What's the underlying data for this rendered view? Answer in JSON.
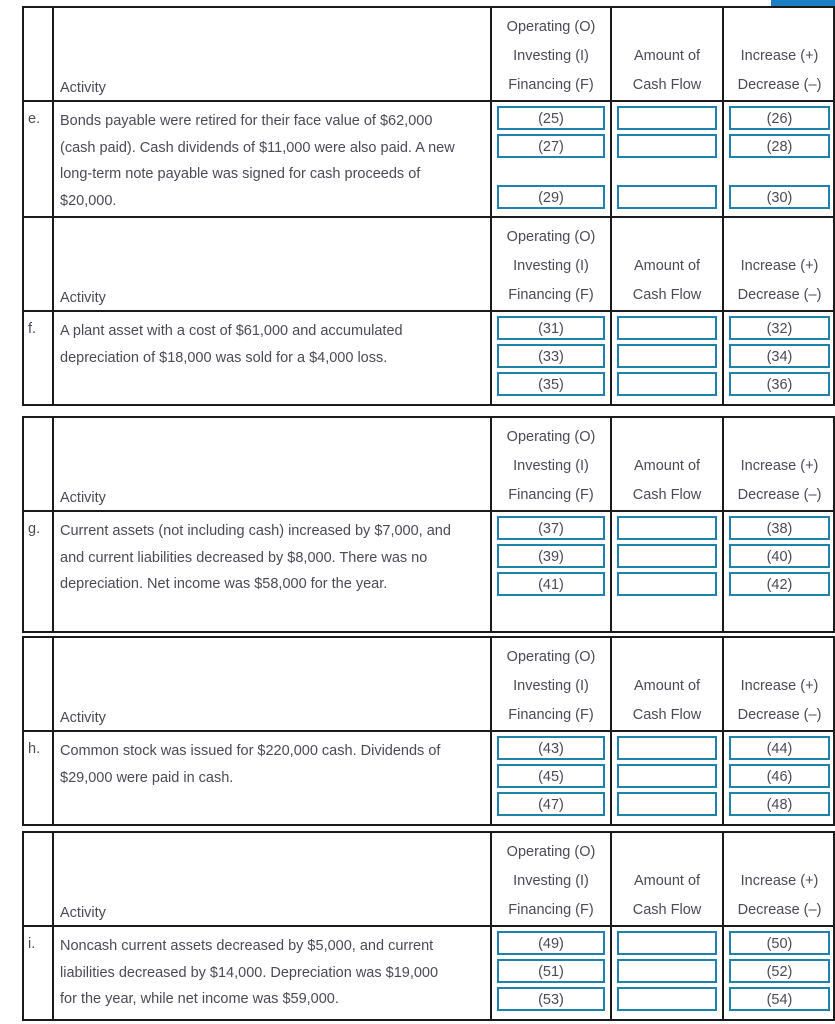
{
  "accent_color": "#1d7fc3",
  "field_border_color": "#1f82ab",
  "text_color": "#4a4a55",
  "headers": {
    "activity": "Activity",
    "classification_line1": "Operating (O)",
    "classification_line2": "Investing (I)",
    "classification_line3": "Financing (F)",
    "amount_line1": "Amount of",
    "amount_line2": "Cash Flow",
    "effect_line1": "Increase (+)",
    "effect_line2": "Decrease (–)"
  },
  "blocks": [
    {
      "letter": "e.",
      "activity_lines": [
        "Bonds payable were retired for their face value of $62,000",
        "(cash paid). Cash dividends of $11,000 were also paid. A new",
        "long-term note payable was signed for cash proceeds of",
        "$20,000."
      ],
      "layout": "gap-before-third",
      "classification": [
        "(25)",
        "(27)",
        "(29)"
      ],
      "amount": [
        "",
        "",
        ""
      ],
      "effect": [
        "(26)",
        "(28)",
        "(30)"
      ]
    },
    {
      "letter": "f.",
      "activity_lines": [
        "A plant asset with a cost of $61,000 and accumulated",
        "depreciation of $18,000 was sold for a $4,000 loss."
      ],
      "layout": "compact",
      "classification": [
        "(31)",
        "(33)",
        "(35)"
      ],
      "amount": [
        "",
        "",
        ""
      ],
      "effect": [
        "(32)",
        "(34)",
        "(36)"
      ]
    },
    {
      "letter": "g.",
      "activity_lines": [
        "Current assets (not including cash) increased by $7,000, and",
        "and current liabilities decreased by $8,000. There was no",
        "depreciation. Net income was $58,000 for the year."
      ],
      "layout": "gap-after-third",
      "classification": [
        "(37)",
        "(39)",
        "(41)"
      ],
      "amount": [
        "",
        "",
        ""
      ],
      "effect": [
        "(38)",
        "(40)",
        "(42)"
      ]
    },
    {
      "letter": "h.",
      "activity_lines": [
        "Common stock was issued for $220,000 cash. Dividends of",
        "$29,000 were paid in cash."
      ],
      "layout": "compact",
      "classification": [
        "(43)",
        "(45)",
        "(47)"
      ],
      "amount": [
        "",
        "",
        ""
      ],
      "effect": [
        "(44)",
        "(46)",
        "(48)"
      ]
    },
    {
      "letter": "i.",
      "activity_lines": [
        "Noncash current assets decreased by $5,000, and current",
        "liabilities decreased by $14,000. Depreciation was $19,000",
        "for the year, while net income was $59,000."
      ],
      "layout": "compact",
      "classification": [
        "(49)",
        "(51)",
        "(53)"
      ],
      "amount": [
        "",
        "",
        ""
      ],
      "effect": [
        "(50)",
        "(52)",
        "(54)"
      ]
    }
  ]
}
